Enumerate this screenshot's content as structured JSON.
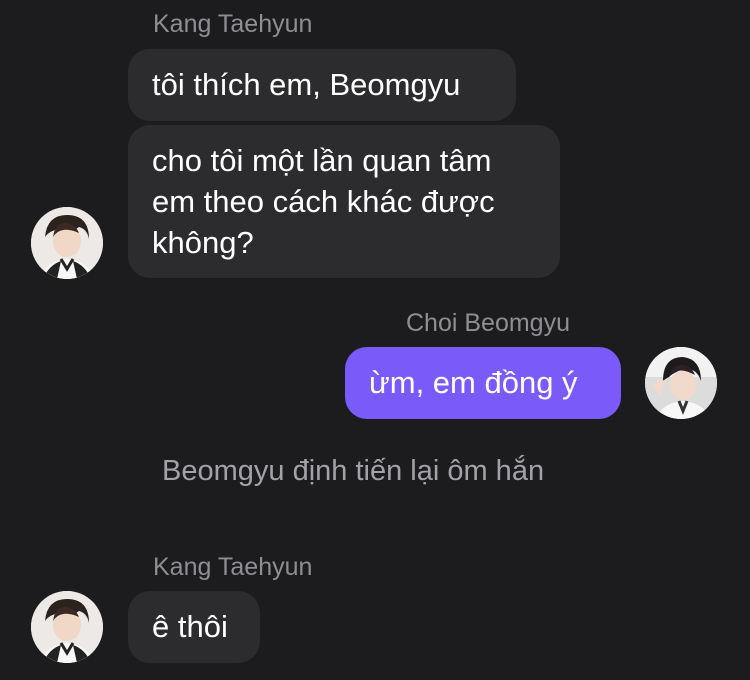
{
  "messages": [
    {
      "sender": "Kang Taehyun",
      "lines": [
        "tôi thích em, Beomgyu"
      ]
    },
    {
      "lines": [
        "cho tôi một lần quan tâm",
        "em theo cách khác được",
        "không?"
      ]
    },
    {
      "sender": "Choi Beomgyu",
      "lines": [
        "ừm, em đồng ý"
      ]
    },
    {
      "narration": "Beomgyu định tiến lại ôm hắn"
    },
    {
      "sender": "Kang Taehyun",
      "lines": [
        "ê thôi"
      ]
    }
  ],
  "colors": {
    "background": "#1c1c1e",
    "incoming_bubble": "#2c2c2e",
    "outgoing_bubble": "#7a5af8",
    "sender_name": "#8e8e93"
  },
  "icons": [
    "avatar-kang-taehyun",
    "avatar-choi-beomgyu"
  ]
}
